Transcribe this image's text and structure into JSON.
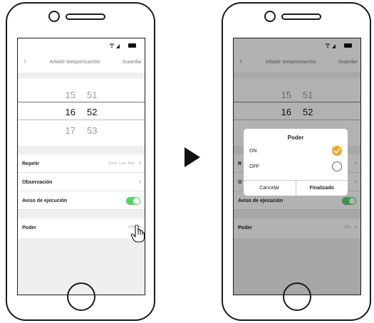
{
  "left_screen": {
    "nav": {
      "back_icon": "chevron-left-icon",
      "title": "Añadir temporización",
      "save": "Guardar"
    },
    "picker": {
      "rows": [
        {
          "hour": "15",
          "minute": "51"
        },
        {
          "hour": "16",
          "minute": "52"
        },
        {
          "hour": "17",
          "minute": "53"
        }
      ]
    },
    "list": {
      "repeat_label": "Repetir",
      "repeat_value": "Dom, Lun, Mar",
      "observation_label": "Observación",
      "notice_label": "Aviso de ejecución",
      "power_label": "Poder",
      "power_value": "ON"
    }
  },
  "right_screen": {
    "nav": {
      "back_icon": "chevron-left-icon",
      "title": "Añadir temporización",
      "save": "Guardar"
    },
    "picker": {
      "rows": [
        {
          "hour": "15",
          "minute": "51"
        },
        {
          "hour": "16",
          "minute": "52"
        }
      ]
    },
    "list": {
      "repeat_label": "R",
      "observation_label": "O",
      "notice_label": "Aviso de ejecución",
      "power_label": "Poder",
      "power_value": "ON"
    },
    "dialog": {
      "title": "Poder",
      "option_on": "ON",
      "option_off": "OFF",
      "cancel": "Cancelar",
      "confirm": "Finalizado"
    }
  },
  "colors": {
    "toggle_on": "#4cd964",
    "checked": "#f5a623"
  }
}
